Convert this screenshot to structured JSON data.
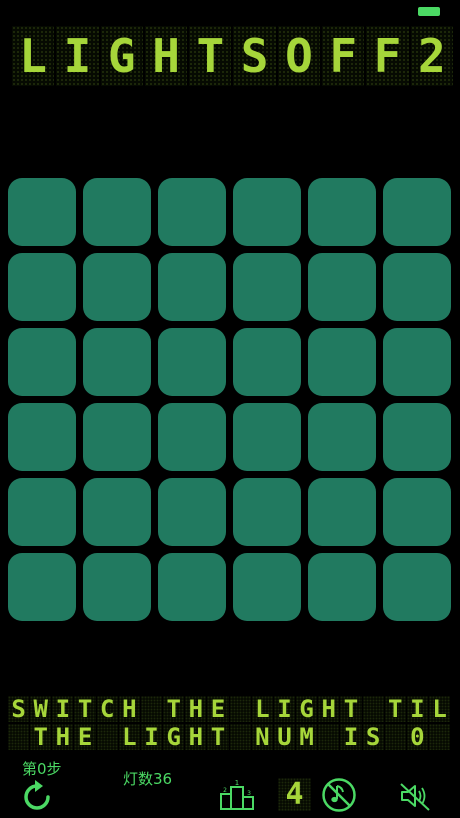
{
  "status_bar": {
    "battery_color": "#4bd964"
  },
  "title": {
    "text": "LIGHTSOFF2",
    "chars": [
      "L",
      "I",
      "G",
      "H",
      "T",
      "S",
      "O",
      "F",
      "F",
      "2"
    ],
    "color": "#a6d63a"
  },
  "board": {
    "rows": 6,
    "cols": 6,
    "tile_color": "#217a60",
    "states": [
      [
        "on",
        "on",
        "on",
        "on",
        "on",
        "on"
      ],
      [
        "on",
        "on",
        "on",
        "on",
        "on",
        "on"
      ],
      [
        "on",
        "on",
        "on",
        "on",
        "on",
        "on"
      ],
      [
        "on",
        "on",
        "on",
        "on",
        "on",
        "on"
      ],
      [
        "on",
        "on",
        "on",
        "on",
        "on",
        "on"
      ],
      [
        "on",
        "on",
        "on",
        "on",
        "on",
        "on"
      ]
    ]
  },
  "message": {
    "line1": "SWITCH THE LIGHT TIL",
    "line2": " THE LIGHT NUM IS 0 "
  },
  "footer": {
    "steps_label": "第0步",
    "lights_label": "灯数36",
    "level_value": "4",
    "accent_color": "#4bd964",
    "icons": [
      "reset-icon",
      "rank-icon",
      "level-icon",
      "music-off-icon",
      "sound-off-icon"
    ]
  }
}
